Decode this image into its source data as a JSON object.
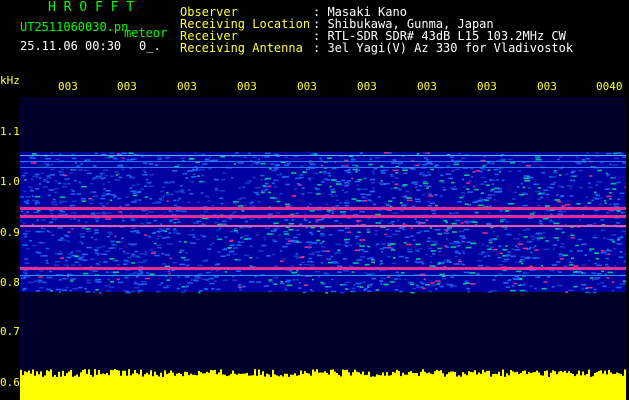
{
  "header": {
    "program_title": "H R O F F T",
    "filename": "UT2511060030.pn",
    "filename_suffix": "meteor",
    "datetime": "25.11.06 00:30",
    "extra": "0_.",
    "info_labels": [
      "Observer",
      "Receiving Location",
      "Receiver",
      "Receiving Antenna"
    ],
    "info_values": [
      ": Masaki Kano",
      ": Shibukawa, Gunma, Japan",
      ": RTL-SDR SDR# 43dB L15 103.2MHz CW",
      ": 3el Yagi(V) Az 330 for Vladivostok"
    ]
  },
  "axis": {
    "freq_unit": "kHz",
    "freq_ticks": [
      "1.1",
      "1.0",
      "0.9",
      "0.8",
      "0.7",
      "0.6"
    ],
    "time_ticks": [
      "003",
      "003",
      "003",
      "003",
      "003",
      "003",
      "003",
      "003",
      "003",
      "0040"
    ]
  },
  "colors": {
    "background": "#000000",
    "title": "#00ff00",
    "label": "#ffff33",
    "band_low": "#0000a0",
    "band_mid": "#2070ff",
    "band_high": "#00e0a0",
    "strong": "#ff3090",
    "noise_floor": "#ffff00"
  }
}
